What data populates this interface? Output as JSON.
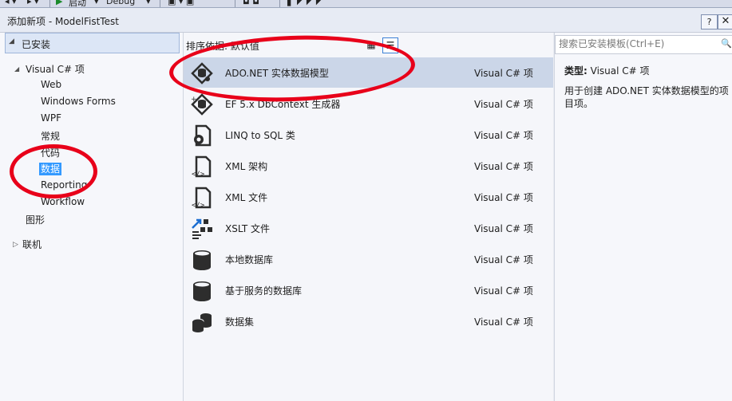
{
  "toolbar": {
    "start_label": "启动",
    "config_label": "Debug"
  },
  "dialog": {
    "title": "添加新项 - ModelFistTest",
    "help_label": "?",
    "close_label": "✕"
  },
  "tree": {
    "installed_label": "已安装",
    "visual_csharp_label": "Visual C# 项",
    "children": [
      "Web",
      "Windows Forms",
      "WPF",
      "常规",
      "代码",
      "数据",
      "Reporting",
      "Workflow"
    ],
    "selected": "数据",
    "graphics_label": "图形",
    "online_label": "联机"
  },
  "sort": {
    "label": "排序依据: 默认值"
  },
  "templates": [
    {
      "name": "ADO.NET 实体数据模型",
      "lang": "Visual C# 项",
      "icon": "entity-model-icon"
    },
    {
      "name": "EF 5.x DbContext 生成器",
      "lang": "Visual C# 项",
      "icon": "dbcontext-generator-icon"
    },
    {
      "name": "LINQ to SQL 类",
      "lang": "Visual C# 项",
      "icon": "linq-to-sql-icon"
    },
    {
      "name": "XML 架构",
      "lang": "Visual C# 项",
      "icon": "xml-schema-icon"
    },
    {
      "name": "XML 文件",
      "lang": "Visual C# 项",
      "icon": "xml-file-icon"
    },
    {
      "name": "XSLT 文件",
      "lang": "Visual C# 项",
      "icon": "xslt-file-icon"
    },
    {
      "name": "本地数据库",
      "lang": "Visual C# 项",
      "icon": "local-database-icon"
    },
    {
      "name": "基于服务的数据库",
      "lang": "Visual C# 项",
      "icon": "service-database-icon"
    },
    {
      "name": "数据集",
      "lang": "Visual C# 项",
      "icon": "dataset-icon"
    }
  ],
  "search": {
    "placeholder": "搜索已安装模板(Ctrl+E)"
  },
  "details": {
    "type_label": "类型:",
    "type_value": "Visual C# 项",
    "description": "用于创建 ADO.NET 实体数据模型的项目项。"
  },
  "colors": {
    "annotation": "#e8001a",
    "selection": "#3399ff",
    "selected_row": "#cbd6e8"
  }
}
